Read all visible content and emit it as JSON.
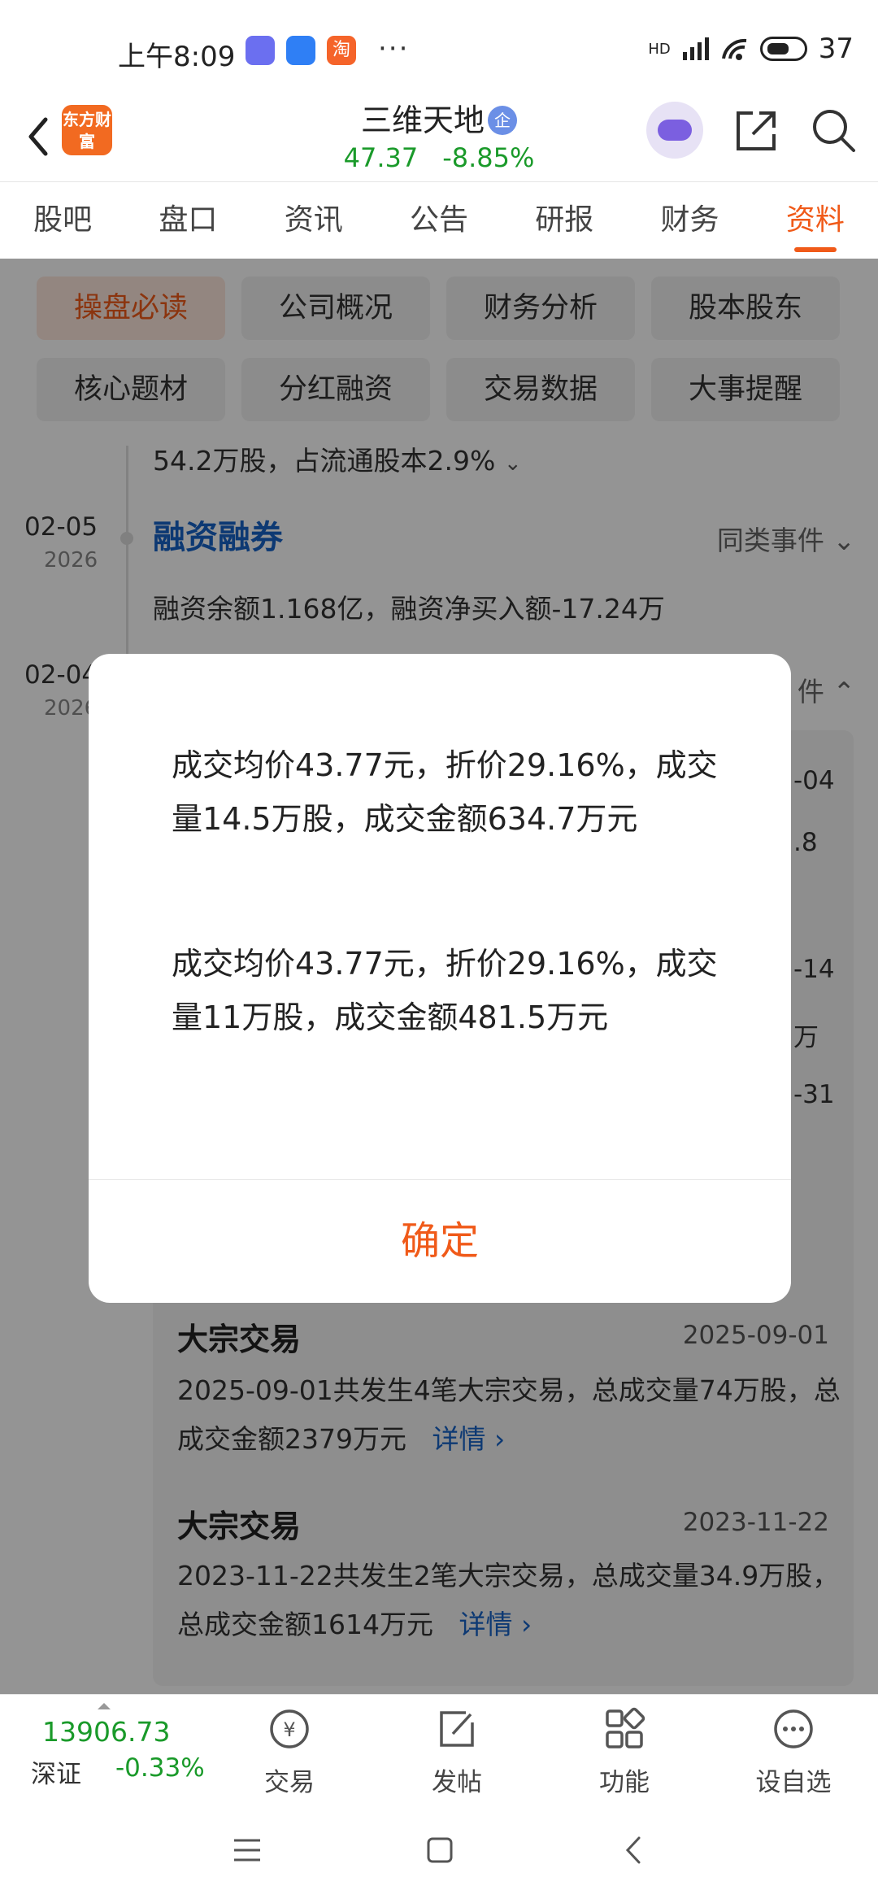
{
  "status_bar": {
    "time": "上午8:09",
    "app_badges": [
      {
        "icon": "chat-app-icon",
        "color": "#6b6ff0",
        "text": ""
      },
      {
        "icon": "mail-app-icon",
        "color": "#2f7ff5",
        "text": ""
      },
      {
        "icon": "taobao-app-icon",
        "color": "#f5642a",
        "text": "淘"
      }
    ],
    "more": "···",
    "network": "HD",
    "battery": "37"
  },
  "header": {
    "logo_text": "东方财富",
    "stock_name": "三维天地",
    "enterprise_badge": "企",
    "price": "47.37",
    "change_pct": "-8.85%"
  },
  "tabs": [
    {
      "label": "股吧",
      "active": false
    },
    {
      "label": "盘口",
      "active": false
    },
    {
      "label": "资讯",
      "active": false
    },
    {
      "label": "公告",
      "active": false
    },
    {
      "label": "研报",
      "active": false
    },
    {
      "label": "财务",
      "active": false
    },
    {
      "label": "资料",
      "active": true
    }
  ],
  "chips": [
    {
      "label": "操盘必读",
      "active": true
    },
    {
      "label": "公司概况",
      "active": false
    },
    {
      "label": "财务分析",
      "active": false
    },
    {
      "label": "股本股东",
      "active": false
    },
    {
      "label": "核心题材",
      "active": false
    },
    {
      "label": "分红融资",
      "active": false
    },
    {
      "label": "交易数据",
      "active": false
    },
    {
      "label": "大事提醒",
      "active": false
    }
  ],
  "timeline": {
    "top_text": "54.2万股，占流通股本2.9%",
    "event1": {
      "date": "02-05",
      "year": "2026",
      "title": "融资融券",
      "same_label": "同类事件",
      "text": "融资余额1.168亿，融资净买入额-17.24万"
    },
    "event2": {
      "date": "02-04",
      "year": "2026",
      "same_label": "件"
    },
    "card_fragments": [
      "-04",
      ".8",
      "-14",
      "万",
      "-31"
    ],
    "blocks": [
      {
        "title": "大宗交易",
        "date": "2025-09-01",
        "text": "2025-09-01共发生4笔大宗交易，总成交量74万股，总成交金额2379万元",
        "more": "详情"
      },
      {
        "title": "大宗交易",
        "date": "2023-11-22",
        "text": "2023-11-22共发生2笔大宗交易，总成交量34.9万股，总成交金额1614万元",
        "more": "详情"
      }
    ]
  },
  "dialog": {
    "paragraphs": [
      "成交均价43.77元，折价29.16%，成交量14.5万股，成交金额634.7万元",
      "成交均价43.77元，折价29.16%，成交量11万股，成交金额481.5万元"
    ],
    "confirm": "确定"
  },
  "bottom_bar": {
    "index_value": "13906.73",
    "index_name": "深证",
    "index_change": "-0.33%",
    "items": [
      {
        "label": "交易",
        "icon": "trade-icon"
      },
      {
        "label": "发帖",
        "icon": "post-icon"
      },
      {
        "label": "功能",
        "icon": "grid-icon"
      },
      {
        "label": "设自选",
        "icon": "more-icon"
      }
    ]
  },
  "colors": {
    "accent": "#f05a19",
    "up_down_green": "#1a9a2a",
    "link_blue": "#1763c7"
  }
}
